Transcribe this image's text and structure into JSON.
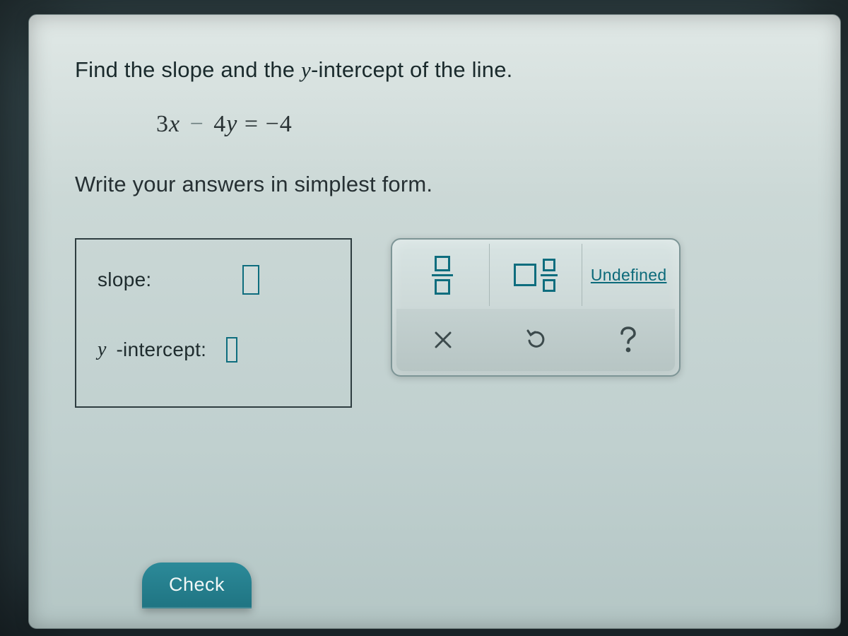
{
  "question": {
    "line1_pre": "Find the slope and the ",
    "line1_var": "y",
    "line1_post": "-intercept of the line.",
    "equation": {
      "a": "3",
      "xvar": "x",
      "op1": "−",
      "b": "4",
      "yvar": "y",
      "eq": "=",
      "c": "−4"
    },
    "instruction": "Write your answers in simplest form."
  },
  "answers": {
    "slope_label": "slope:",
    "yint_var": "y",
    "yint_post": "-intercept:"
  },
  "keypad": {
    "undefined_label": "Undefined"
  },
  "footer": {
    "check_label": "Check"
  }
}
